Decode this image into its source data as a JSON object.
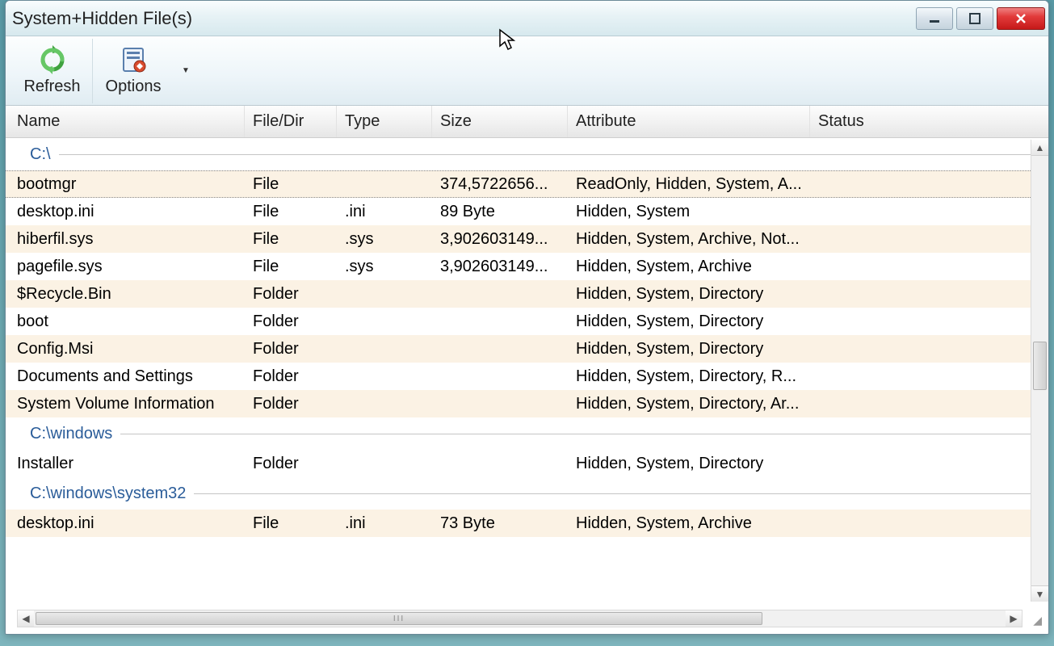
{
  "window": {
    "title": "System+Hidden File(s)"
  },
  "toolbar": {
    "refresh_label": "Refresh",
    "options_label": "Options"
  },
  "columns": {
    "name": "Name",
    "filedir": "File/Dir",
    "type": "Type",
    "size": "Size",
    "attribute": "Attribute",
    "status": "Status"
  },
  "groups": [
    {
      "path": "C:\\",
      "rows": [
        {
          "name": "bootmgr",
          "filedir": "File",
          "type": "",
          "size": "374,5722656...",
          "attribute": "ReadOnly, Hidden, System, A...",
          "status": ""
        },
        {
          "name": "desktop.ini",
          "filedir": "File",
          "type": ".ini",
          "size": "89 Byte",
          "attribute": "Hidden, System",
          "status": ""
        },
        {
          "name": "hiberfil.sys",
          "filedir": "File",
          "type": ".sys",
          "size": "3,902603149...",
          "attribute": "Hidden, System, Archive, Not...",
          "status": ""
        },
        {
          "name": "pagefile.sys",
          "filedir": "File",
          "type": ".sys",
          "size": "3,902603149...",
          "attribute": "Hidden, System, Archive",
          "status": ""
        },
        {
          "name": "$Recycle.Bin",
          "filedir": "Folder",
          "type": "",
          "size": "",
          "attribute": "Hidden, System, Directory",
          "status": ""
        },
        {
          "name": "boot",
          "filedir": "Folder",
          "type": "",
          "size": "",
          "attribute": "Hidden, System, Directory",
          "status": ""
        },
        {
          "name": "Config.Msi",
          "filedir": "Folder",
          "type": "",
          "size": "",
          "attribute": "Hidden, System, Directory",
          "status": ""
        },
        {
          "name": "Documents and Settings",
          "filedir": "Folder",
          "type": "",
          "size": "",
          "attribute": "Hidden, System, Directory, R...",
          "status": ""
        },
        {
          "name": "System Volume Information",
          "filedir": "Folder",
          "type": "",
          "size": "",
          "attribute": "Hidden, System, Directory, Ar...",
          "status": ""
        }
      ]
    },
    {
      "path": "C:\\windows",
      "rows": [
        {
          "name": "Installer",
          "filedir": "Folder",
          "type": "",
          "size": "",
          "attribute": "Hidden, System, Directory",
          "status": ""
        }
      ]
    },
    {
      "path": "C:\\windows\\system32",
      "rows": [
        {
          "name": "desktop.ini",
          "filedir": "File",
          "type": ".ini",
          "size": "73 Byte",
          "attribute": "Hidden, System, Archive",
          "status": ""
        }
      ]
    }
  ]
}
